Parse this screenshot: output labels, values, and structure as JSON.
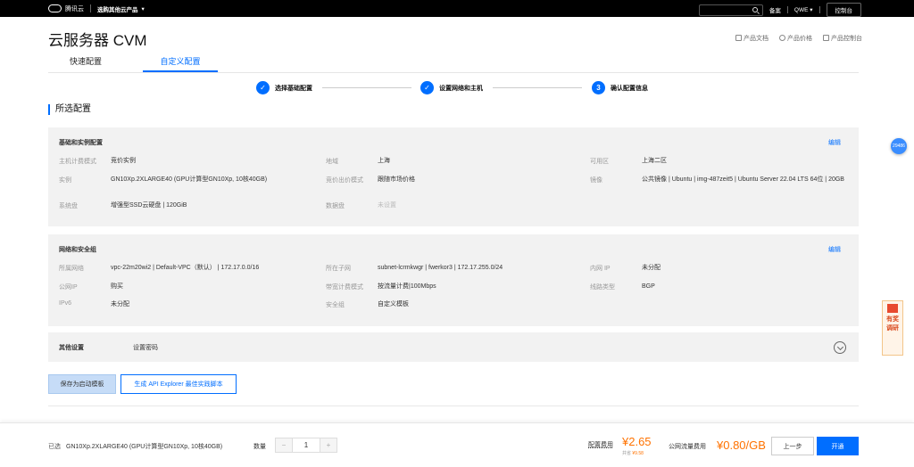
{
  "topbar": {
    "brand": "腾讯云",
    "product_menu": "选购其他云产品",
    "filing": "备案",
    "user": "QWE",
    "console": "控制台"
  },
  "header": {
    "title": "云服务器 CVM",
    "links": [
      "产品文档",
      "产品价格",
      "产品控制台"
    ]
  },
  "tabs": [
    "快速配置",
    "自定义配置"
  ],
  "steps": [
    {
      "label": "选择基础配置",
      "marker": "✓"
    },
    {
      "label": "设置网络和主机",
      "marker": "✓"
    },
    {
      "label": "确认配置信息",
      "marker": "3"
    }
  ],
  "section_title": "所选配置",
  "basic": {
    "title": "基础和实例配置",
    "edit": "编辑",
    "fields": [
      {
        "label": "主机计费模式",
        "value": "竞价实例"
      },
      {
        "label": "地域",
        "value": "上海"
      },
      {
        "label": "可用区",
        "value": "上海二区"
      },
      {
        "label": "实例",
        "value": "GN10Xp.2XLARGE40 (GPU计算型GN10Xp, 10核40GB)"
      },
      {
        "label": "竞价出价模式",
        "value": "跟随市场价格"
      },
      {
        "label": "镜像",
        "value": "公共镜像 | Ubuntu | img-487zeit5 | Ubuntu Server 22.04 LTS 64位 | 20GB"
      },
      {
        "label": "系统盘",
        "value": "增强型SSD云硬盘 | 120GiB"
      },
      {
        "label": "数据盘",
        "value": "未设置"
      }
    ]
  },
  "network": {
    "title": "网络和安全组",
    "edit": "编辑",
    "fields": [
      {
        "label": "所属网络",
        "value": "vpc-22m20wi2 | Default-VPC（默认） | 172.17.0.0/16"
      },
      {
        "label": "所在子网",
        "value": "subnet-lcrmkwgr | fwerkor3 | 172.17.255.0/24"
      },
      {
        "label": "内网 IP",
        "value": "未分配"
      },
      {
        "label": "公网IP",
        "value": "购买"
      },
      {
        "label": "带宽计费模式",
        "value": "按流量计费|100Mbps"
      },
      {
        "label": "线路类型",
        "value": "BGP"
      },
      {
        "label": "IPv6",
        "value": "未分配"
      },
      {
        "label": "安全组",
        "value": "自定义模板"
      }
    ]
  },
  "other": {
    "title": "其他设置",
    "value": "设置密码"
  },
  "actions": {
    "save_template": "保存为启动模板",
    "api_explorer": "生成 API Explorer 最佳实践脚本"
  },
  "footer": {
    "selected_label": "已选",
    "selected_value": "GN10Xp.2XLARGE40 (GPU计算型GN10Xp, 10核40GB)",
    "qty_label": "数量",
    "qty_minus": "−",
    "qty_value": "1",
    "qty_plus": "+",
    "config_fee_label": "配置费用",
    "config_fee": "¥2.65",
    "saved_label": "共省",
    "saved_value": "¥9.58",
    "net_fee_label": "公网流量费用",
    "net_fee": "¥0.80/GB",
    "prev": "上一步",
    "next": "开通"
  },
  "floating": {
    "badge": "29486",
    "gift_text": "有奖调研"
  }
}
